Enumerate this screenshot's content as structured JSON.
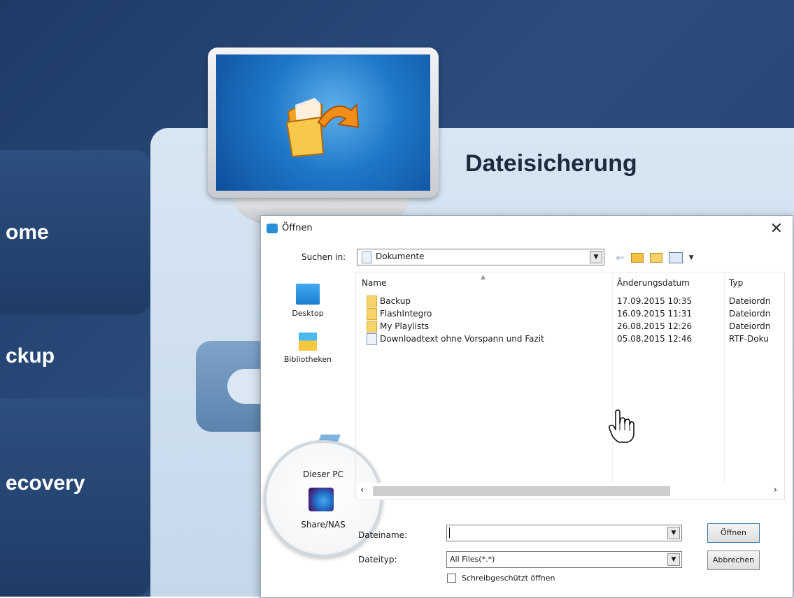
{
  "app": {
    "nav": {
      "home_label": "ome",
      "backup_label": "ckup",
      "recovery_label": "ecovery"
    },
    "panel_title": "Dateisicherung"
  },
  "dialog": {
    "title": "Öffnen",
    "close_glyph": "✕",
    "look_in_label": "Suchen in:",
    "look_in_value": "Dokumente",
    "places": [
      {
        "label": "Desktop"
      },
      {
        "label": "Bibliotheken"
      },
      {
        "label": "Dieser PC"
      },
      {
        "label": "Share/NAS"
      }
    ],
    "columns": {
      "name": "Name",
      "date": "Änderungsdatum",
      "type": "Typ"
    },
    "rows": [
      {
        "name": "Backup",
        "date": "17.09.2015 10:35",
        "type": "Dateiordn",
        "icon": "folder"
      },
      {
        "name": "FlashIntegro",
        "date": "16.09.2015 11:31",
        "type": "Dateiordn",
        "icon": "folder"
      },
      {
        "name": "My Playlists",
        "date": "26.08.2015 12:26",
        "type": "Dateiordn",
        "icon": "folder"
      },
      {
        "name": "Downloadtext ohne Vorspann und Fazit",
        "date": "05.08.2015 12:46",
        "type": "RTF-Doku",
        "icon": "document"
      }
    ],
    "filename_label": "Dateiname:",
    "filename_value": "",
    "filetype_label": "Dateityp:",
    "filetype_value": "All Files(*.*)",
    "readonly_label": "Schreibgeschützt öffnen",
    "open_button": "Öffnen",
    "cancel_button": "Abbrechen"
  }
}
